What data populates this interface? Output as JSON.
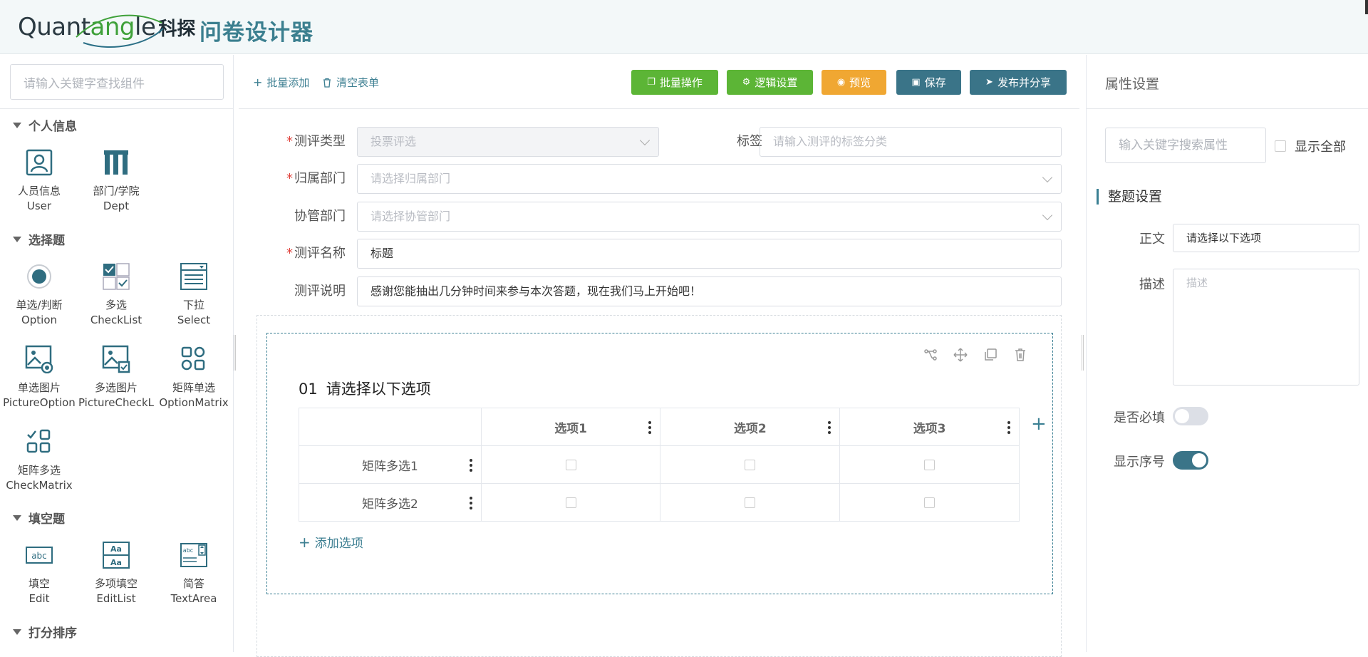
{
  "header": {
    "logo_word_a": "Quant",
    "logo_word_b": "ang",
    "logo_word_c": "le",
    "logo_cn": "科探",
    "title": "问卷设计器"
  },
  "left": {
    "search_placeholder": "请输入关键字查找组件",
    "groups": [
      {
        "title": "个人信息",
        "items": [
          {
            "cn": "人员信息",
            "en": "User",
            "icon": "user-card-icon"
          },
          {
            "cn": "部门/学院",
            "en": "Dept",
            "icon": "columns-icon"
          }
        ]
      },
      {
        "title": "选择题",
        "items": [
          {
            "cn": "单选/判断",
            "en": "Option",
            "icon": "radio-icon"
          },
          {
            "cn": "多选",
            "en": "CheckList",
            "icon": "checklist-icon"
          },
          {
            "cn": "下拉",
            "en": "Select",
            "icon": "select-list-icon"
          },
          {
            "cn": "单选图片",
            "en": "PictureOption",
            "icon": "picture-radio-icon"
          },
          {
            "cn": "多选图片",
            "en": "PictureCheckL",
            "icon": "picture-check-icon"
          },
          {
            "cn": "矩阵单选",
            "en": "OptionMatrix",
            "icon": "option-matrix-icon"
          },
          {
            "cn": "矩阵多选",
            "en": "CheckMatrix",
            "icon": "check-matrix-icon"
          }
        ]
      },
      {
        "title": "填空题",
        "items": [
          {
            "cn": "填空",
            "en": "Edit",
            "icon": "abc-input-icon"
          },
          {
            "cn": "多项填空",
            "en": "EditList",
            "icon": "aa-list-icon"
          },
          {
            "cn": "简答",
            "en": "TextArea",
            "icon": "textarea-icon"
          }
        ]
      },
      {
        "title": "打分排序",
        "items": []
      }
    ]
  },
  "toolbar": {
    "batch_add": "批量添加",
    "clear_form": "清空表单",
    "buttons": [
      {
        "label": "批量操作",
        "color": "#5cb536"
      },
      {
        "label": "逻辑设置",
        "color": "#5cb536"
      },
      {
        "label": "预览",
        "color": "#f0a732"
      },
      {
        "label": "保存",
        "color": "#3a7488"
      },
      {
        "label": "发布并分享",
        "color": "#3a7488"
      }
    ]
  },
  "form": {
    "type_label": "测评类型",
    "type_value": "投票评选",
    "tag_label": "标签",
    "tag_placeholder": "请输入测评的标签分类",
    "dept_label": "归属部门",
    "dept_placeholder": "请选择归属部门",
    "co_dept_label": "协管部门",
    "co_dept_placeholder": "请选择协管部门",
    "name_label": "测评名称",
    "name_value": "标题",
    "desc_label": "测评说明",
    "desc_value": "感谢您能抽出几分钟时间来参与本次答题，现在我们马上开始吧！"
  },
  "question": {
    "number": "01",
    "title": "请选择以下选项",
    "columns": [
      "选项1",
      "选项2",
      "选项3"
    ],
    "rows": [
      "矩阵多选1",
      "矩阵多选2"
    ],
    "add_option": "添加选项",
    "add_column": "+"
  },
  "props": {
    "title": "属性设置",
    "search_placeholder": "输入关键字搜索属性",
    "show_all": "显示全部",
    "section": "整题设置",
    "body_label": "正文",
    "body_value": "请选择以下选项",
    "desc_label": "描述",
    "desc_placeholder": "描述",
    "required_label": "是否必填",
    "required": false,
    "show_index_label": "显示序号",
    "show_index": true,
    "accent": "#3a7488"
  }
}
